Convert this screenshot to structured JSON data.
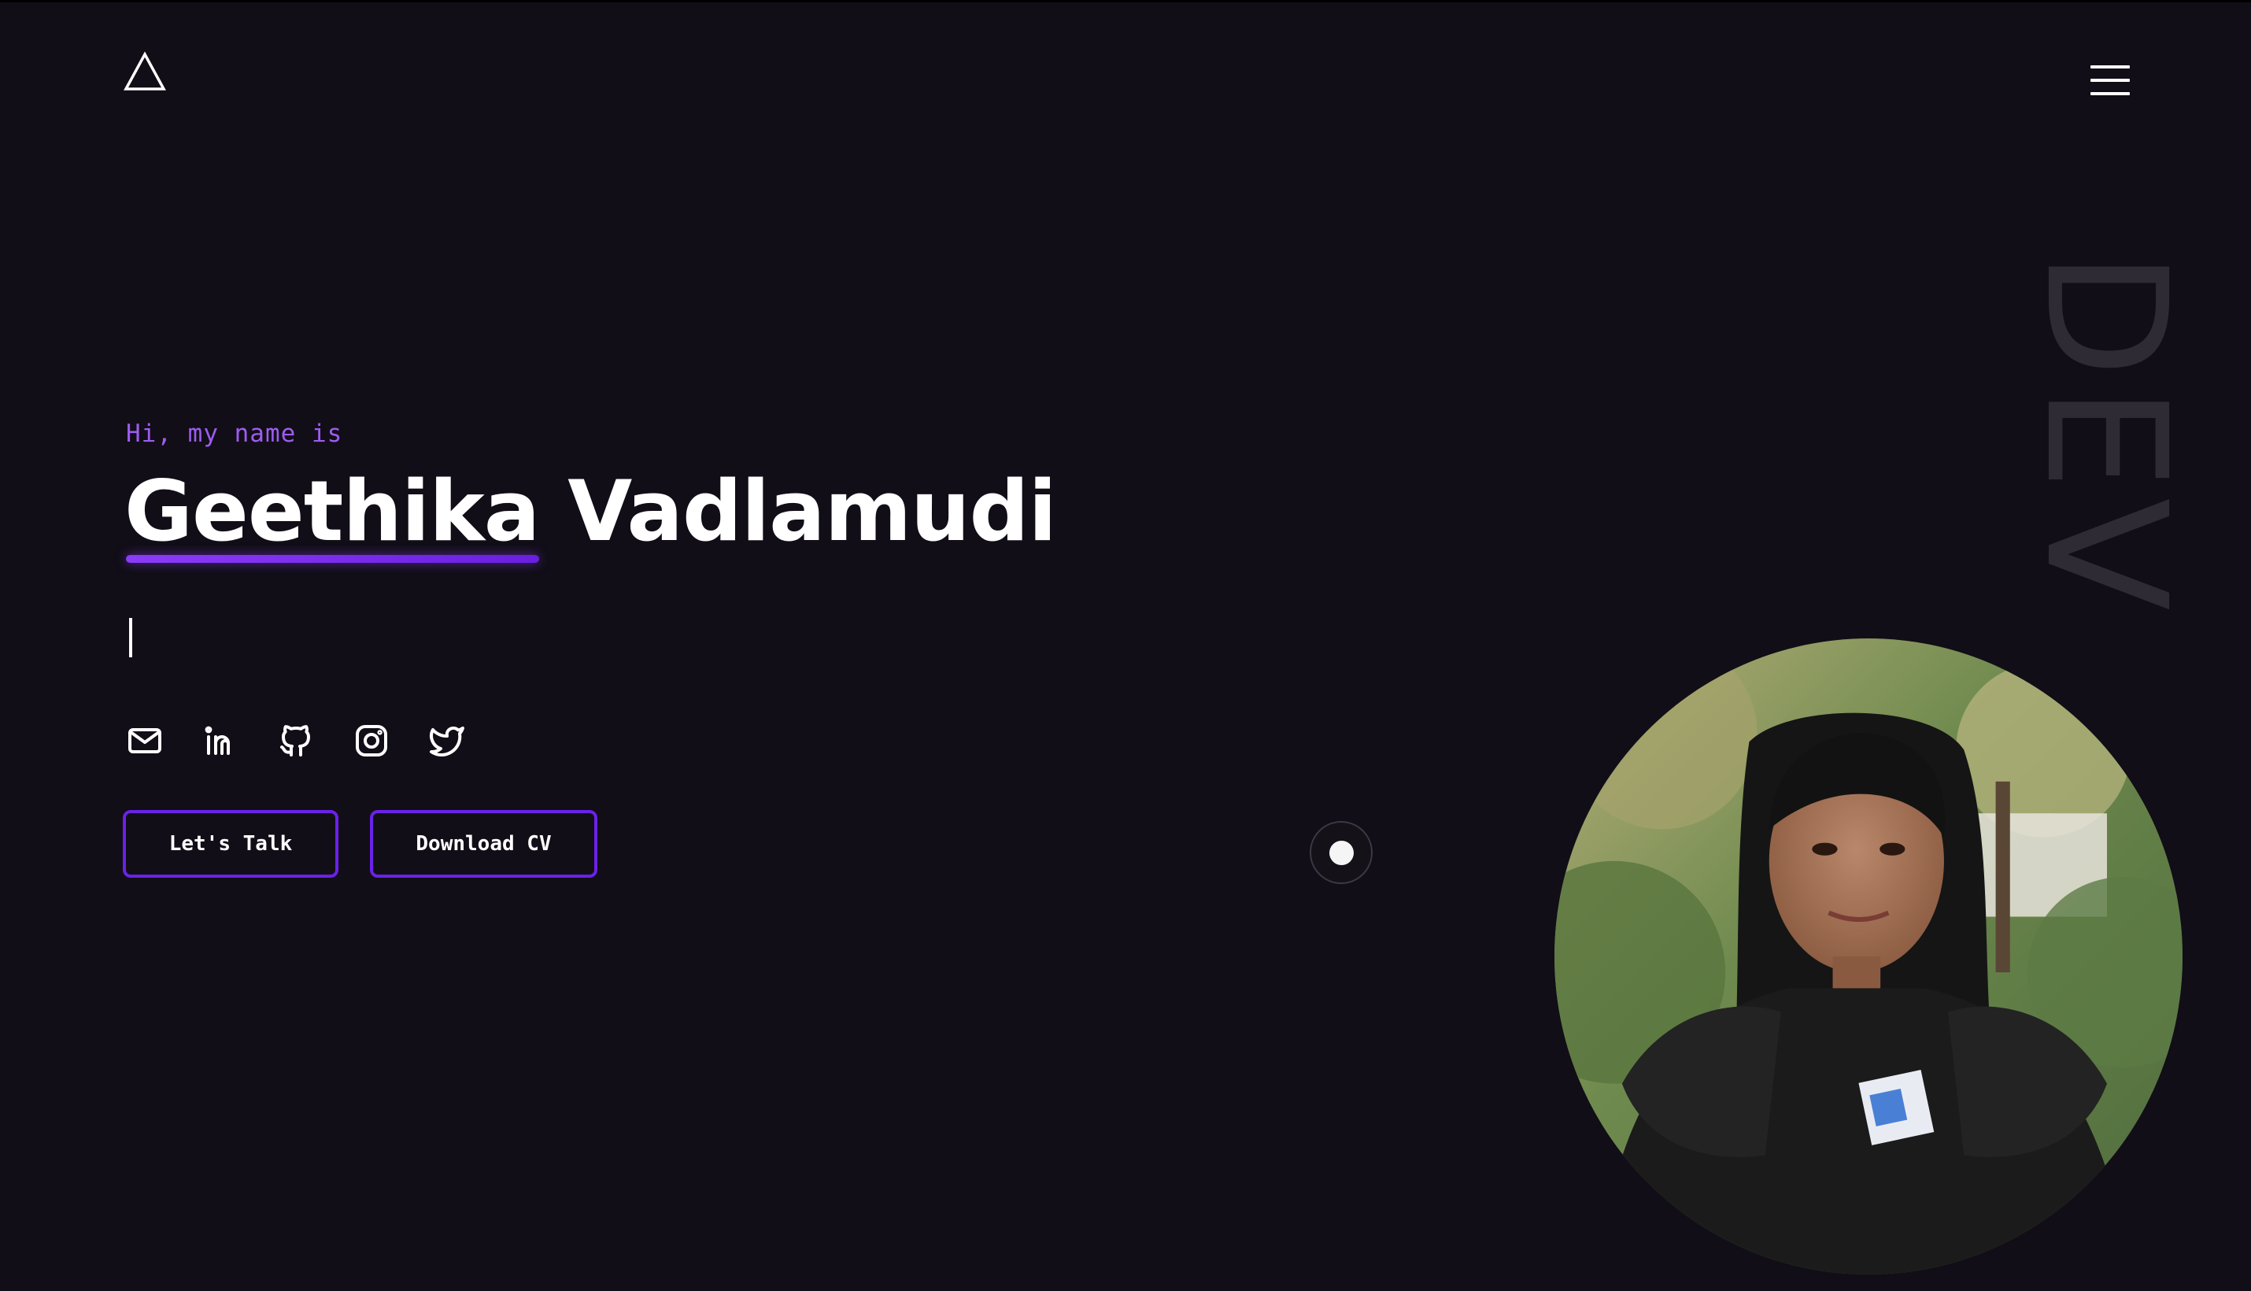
{
  "header": {
    "logo_icon": "triangle-logo-icon",
    "menu_icon": "hamburger-menu-icon"
  },
  "side_text": "DEV",
  "hero": {
    "intro": "Hi, my name is",
    "first_name": "Geethika",
    "last_name": "Vadlamudi"
  },
  "socials": [
    {
      "icon": "mail-icon"
    },
    {
      "icon": "linkedin-icon"
    },
    {
      "icon": "github-icon"
    },
    {
      "icon": "instagram-icon"
    },
    {
      "icon": "twitter-icon"
    }
  ],
  "buttons": {
    "talk_label": "Let's Talk",
    "cv_label": "Download CV"
  },
  "colors": {
    "background": "#110e17",
    "accent": "#6b21e8",
    "intro_text": "#9d5cf0"
  }
}
